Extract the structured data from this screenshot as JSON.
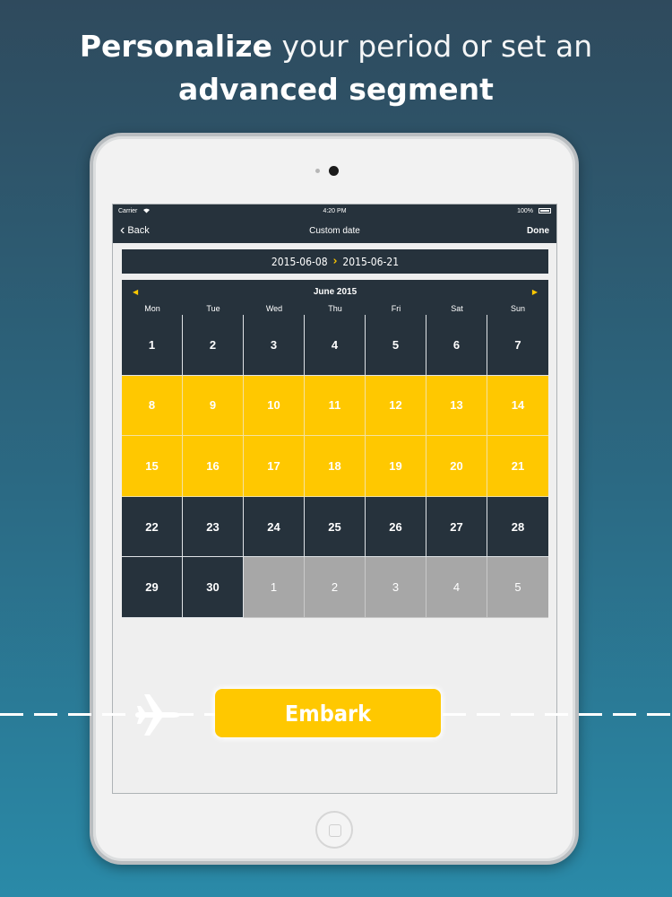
{
  "headline": {
    "line1_bold": "Personalize",
    "line1_rest": "your period or set an",
    "line2_bold": "advanced segment"
  },
  "statusbar": {
    "carrier": "Carrier",
    "time": "4:20 PM",
    "battery": "100%"
  },
  "navbar": {
    "back_label": "Back",
    "title": "Custom date",
    "done_label": "Done"
  },
  "range": {
    "start": "2015-06-08",
    "end": "2015-06-21",
    "arrow_glyph": "›"
  },
  "calendar": {
    "month_label": "June 2015",
    "weekdays": [
      "Mon",
      "Tue",
      "Wed",
      "Thu",
      "Fri",
      "Sat",
      "Sun"
    ],
    "weeks": [
      [
        "1",
        "2",
        "3",
        "4",
        "5",
        "6",
        "7"
      ],
      [
        "8",
        "9",
        "10",
        "11",
        "12",
        "13",
        "14"
      ],
      [
        "15",
        "16",
        "17",
        "18",
        "19",
        "20",
        "21"
      ],
      [
        "22",
        "23",
        "24",
        "25",
        "26",
        "27",
        "28"
      ],
      [
        "29",
        "30",
        "1",
        "2",
        "3",
        "4",
        "5"
      ]
    ],
    "colors": {
      "default": "#26323c",
      "selected": "#ffc800",
      "other_month": "#a7a7a7"
    }
  },
  "button": {
    "embark_label": "Embark"
  },
  "icons": [
    "back-chevron-icon",
    "wifi-icon",
    "battery-icon",
    "prev-month-icon",
    "next-month-icon",
    "airplane-icon",
    "home-button-icon",
    "camera-icon"
  ]
}
